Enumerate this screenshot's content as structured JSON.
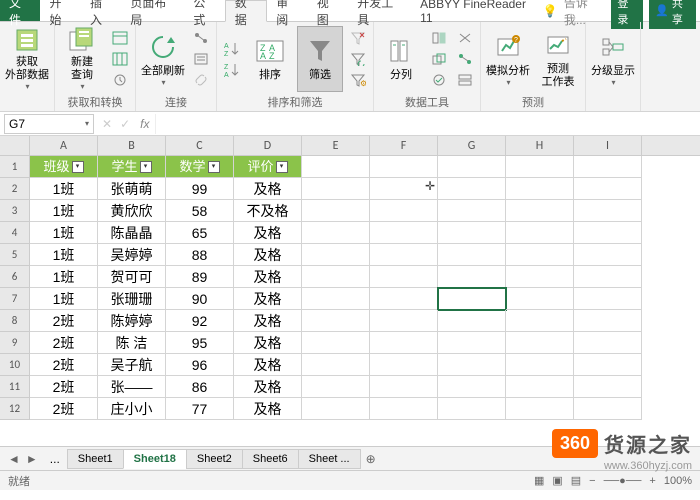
{
  "tabs": {
    "file": "文件",
    "home": "开始",
    "insert": "插入",
    "layout": "页面布局",
    "formula": "公式",
    "data": "数据",
    "review": "审阅",
    "view": "视图",
    "dev": "开发工具",
    "abbyy": "ABBYY FineReader 11"
  },
  "title_right": {
    "tell": "告诉我...",
    "login": "登录",
    "share": "共享"
  },
  "ribbon": {
    "g1": {
      "btn1": "获取\n外部数据",
      "lbl": ""
    },
    "g2": {
      "btn1": "新建\n查询",
      "lbl": "获取和转换"
    },
    "g3": {
      "btn1": "全部刷新",
      "lbl": "连接"
    },
    "g4": {
      "btn1": "排序",
      "btn2": "筛选",
      "lbl": "排序和筛选"
    },
    "g5": {
      "btn1": "分列",
      "btn2": "模拟分析",
      "btn3": "预测\n工作表",
      "lbl": "数据工具",
      "lbl2": "预测"
    },
    "g6": {
      "btn1": "分级显示",
      "lbl": ""
    }
  },
  "namebox": "G7",
  "cols": [
    "A",
    "B",
    "C",
    "D",
    "E",
    "F",
    "G",
    "H",
    "I"
  ],
  "headers": {
    "c1": "班级",
    "c2": "学生",
    "c3": "数学",
    "c4": "评价"
  },
  "rows": [
    {
      "n": "1",
      "c": [
        "1班",
        "张萌萌",
        "99",
        "及格"
      ]
    },
    {
      "n": "2",
      "c": [
        "1班",
        "黄欣欣",
        "58",
        "不及格"
      ]
    },
    {
      "n": "3",
      "c": [
        "1班",
        "陈晶晶",
        "65",
        "及格"
      ]
    },
    {
      "n": "4",
      "c": [
        "1班",
        "吴婷婷",
        "88",
        "及格"
      ]
    },
    {
      "n": "5",
      "c": [
        "1班",
        "贺可可",
        "89",
        "及格"
      ]
    },
    {
      "n": "6",
      "c": [
        "1班",
        "张珊珊",
        "90",
        "及格"
      ]
    },
    {
      "n": "7",
      "c": [
        "2班",
        "陈婷婷",
        "92",
        "及格"
      ]
    },
    {
      "n": "8",
      "c": [
        "2班",
        "陈 洁",
        "95",
        "及格"
      ]
    },
    {
      "n": "9",
      "c": [
        "2班",
        "吴子航",
        "96",
        "及格"
      ]
    },
    {
      "n": "10",
      "c": [
        "2班",
        "张——",
        "86",
        "及格"
      ]
    },
    {
      "n": "11",
      "c": [
        "2班",
        "庄小小",
        "77",
        "及格"
      ]
    }
  ],
  "sheets": {
    "s1": "Sheet1",
    "s2": "Sheet18",
    "s3": "Sheet2",
    "s4": "Sheet6",
    "s5": "Sheet ..."
  },
  "status": {
    "ready": "就绪",
    "zoom": "100%"
  },
  "watermark": {
    "num": "360",
    "txt": "货源之家",
    "url": "www.360hyzj.com"
  }
}
